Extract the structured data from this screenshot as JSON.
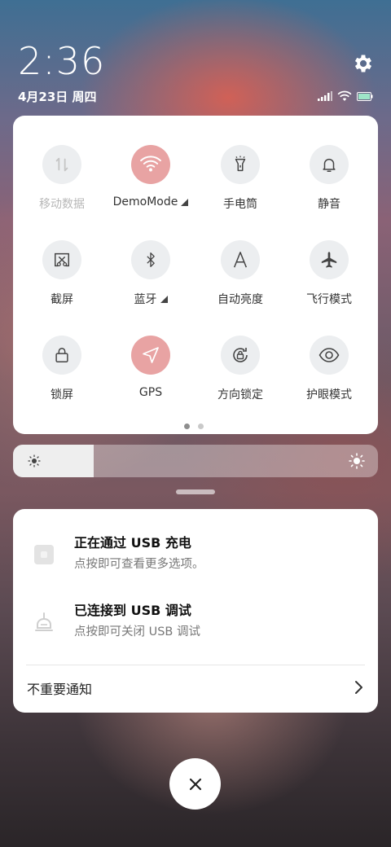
{
  "status": {
    "time": "2:36",
    "date": "4月23日 周四"
  },
  "icons": {
    "settings": "gear-icon",
    "signal": "cellular-signal-icon",
    "wifi": "wifi-icon",
    "battery": "battery-icon"
  },
  "colors": {
    "active_tile": "#e8a3a3",
    "inactive_tile": "#eceef0",
    "disabled_label": "#b7b7b7"
  },
  "quick_settings": {
    "tiles": [
      {
        "label": "移动数据",
        "icon": "mobile-data-icon",
        "state": "disabled"
      },
      {
        "label": "DemoMode",
        "icon": "wifi-icon",
        "state": "active",
        "has_menu": true
      },
      {
        "label": "手电筒",
        "icon": "flashlight-icon",
        "state": "off"
      },
      {
        "label": "静音",
        "icon": "bell-icon",
        "state": "off"
      },
      {
        "label": "截屏",
        "icon": "screenshot-scissors-icon",
        "state": "off"
      },
      {
        "label": "蓝牙",
        "icon": "bluetooth-icon",
        "state": "off",
        "has_menu": true
      },
      {
        "label": "自动亮度",
        "icon": "auto-brightness-icon",
        "state": "off"
      },
      {
        "label": "飞行模式",
        "icon": "airplane-icon",
        "state": "off"
      },
      {
        "label": "锁屏",
        "icon": "lock-icon",
        "state": "off"
      },
      {
        "label": "GPS",
        "icon": "location-arrow-icon",
        "state": "active"
      },
      {
        "label": "方向锁定",
        "icon": "rotation-lock-icon",
        "state": "off"
      },
      {
        "label": "护眼模式",
        "icon": "eye-icon",
        "state": "off"
      }
    ],
    "pages": 2,
    "current_page": 1
  },
  "brightness": {
    "level": 0.22
  },
  "notifications": [
    {
      "title": "正在通过 USB 充电",
      "subtitle": "点按即可查看更多选项。",
      "icon": "usb-charging-icon"
    },
    {
      "title": "已连接到 USB 调试",
      "subtitle": "点按即可关闭 USB 调试",
      "icon": "usb-debug-icon"
    }
  ],
  "unimportant_label": "不重要通知"
}
